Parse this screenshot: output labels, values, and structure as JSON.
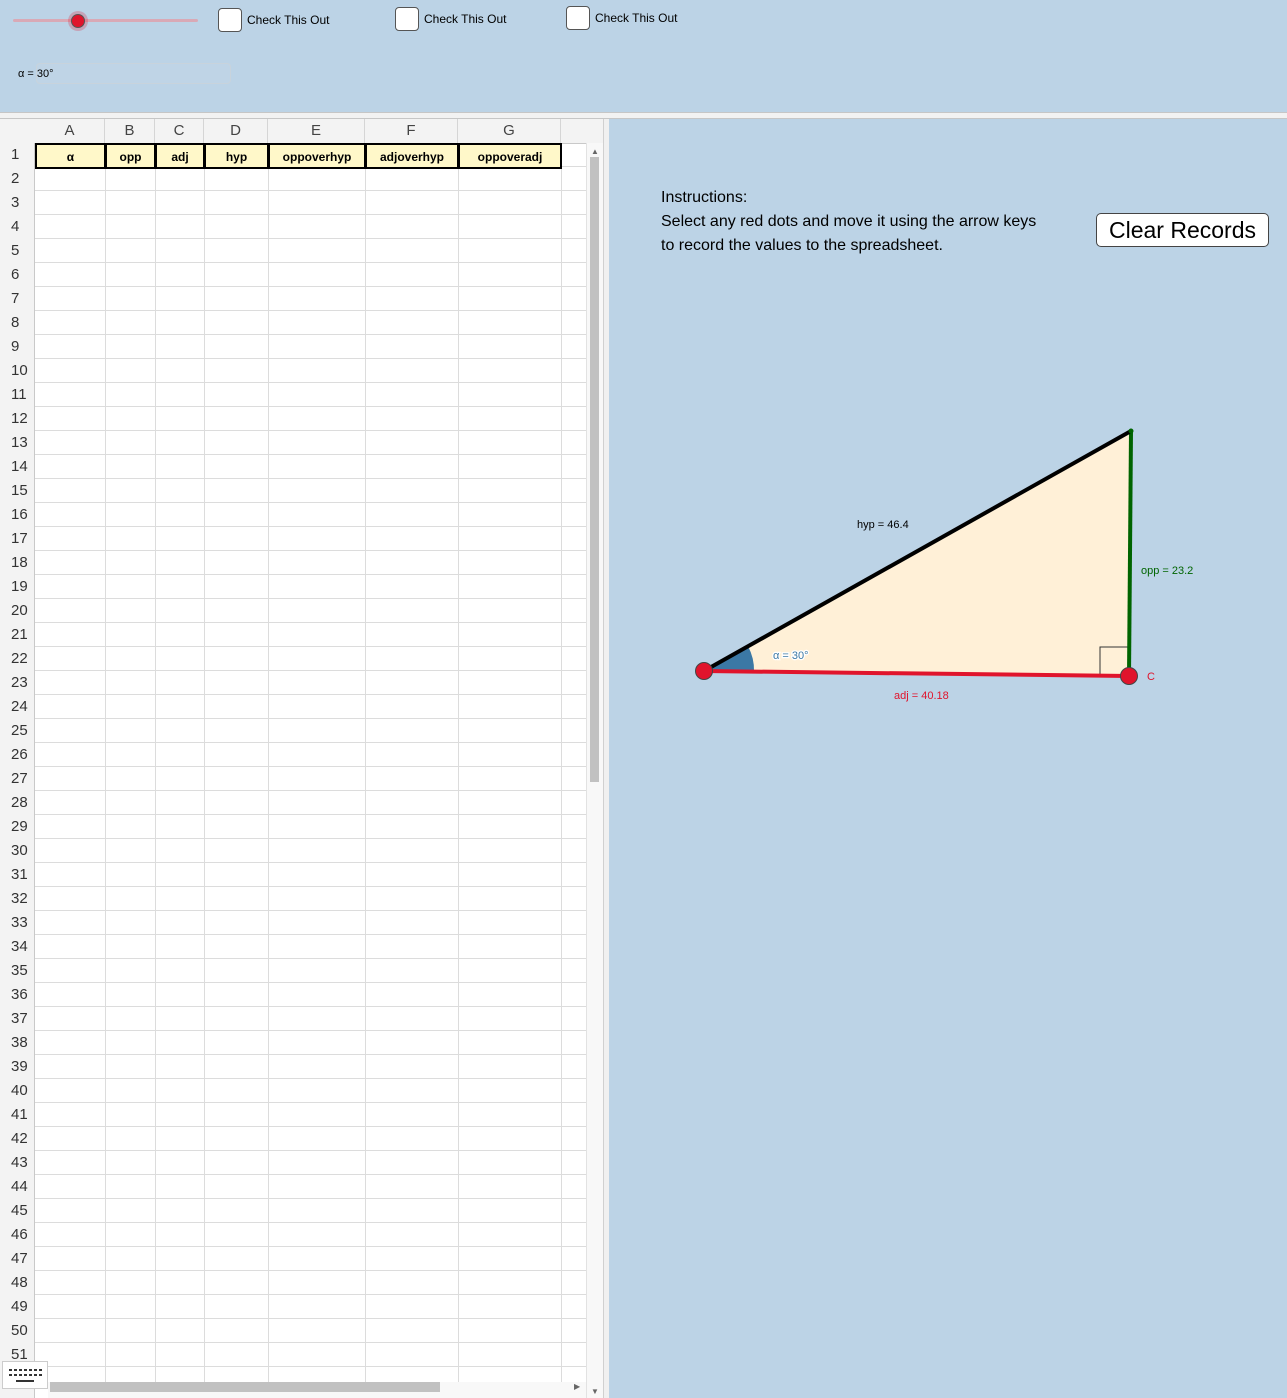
{
  "toolbar": {
    "checkboxes": [
      {
        "label": "Check This Out"
      },
      {
        "label": "Check This Out"
      },
      {
        "label": "Check This Out"
      }
    ],
    "alpha_label": "α = 30°",
    "slider_value_fraction": 0.35
  },
  "spreadsheet": {
    "columns": [
      "A",
      "B",
      "C",
      "D",
      "E",
      "F",
      "G"
    ],
    "header_cells": [
      "α",
      "opp",
      "adj",
      "hyp",
      "oppoverhyp",
      "adjoverhyp",
      "oppoveradj"
    ],
    "row_numbers": [
      "1",
      "2",
      "3",
      "4",
      "5",
      "6",
      "7",
      "8",
      "9",
      "10",
      "11",
      "12",
      "13",
      "14",
      "15",
      "16",
      "17",
      "18",
      "19",
      "20",
      "21",
      "22",
      "23",
      "24",
      "25",
      "26",
      "27",
      "28",
      "29",
      "30",
      "31",
      "32",
      "33",
      "34",
      "35",
      "36",
      "37",
      "38",
      "39",
      "40",
      "41",
      "42",
      "43",
      "44",
      "45",
      "46",
      "47",
      "48",
      "49",
      "50",
      "51"
    ]
  },
  "graphics": {
    "instructions": {
      "title": "Instructions:",
      "line1": "Select any red dots and move it using the arrow keys",
      "line2": "to record the values to the spreadsheet."
    },
    "clear_button_label": "Clear Records",
    "labels": {
      "hyp": "hyp = 46.4",
      "opp": "opp = 23.2",
      "adj": "adj = 40.18",
      "angle": "α = 30°",
      "point_c": "C"
    },
    "colors": {
      "triangle_fill": "#fff0d7",
      "hyp_color": "#000000",
      "opp_color": "#006400",
      "adj_color": "#e0142c",
      "angle_color": "#3b78a5",
      "point_color": "#e0142c"
    }
  }
}
